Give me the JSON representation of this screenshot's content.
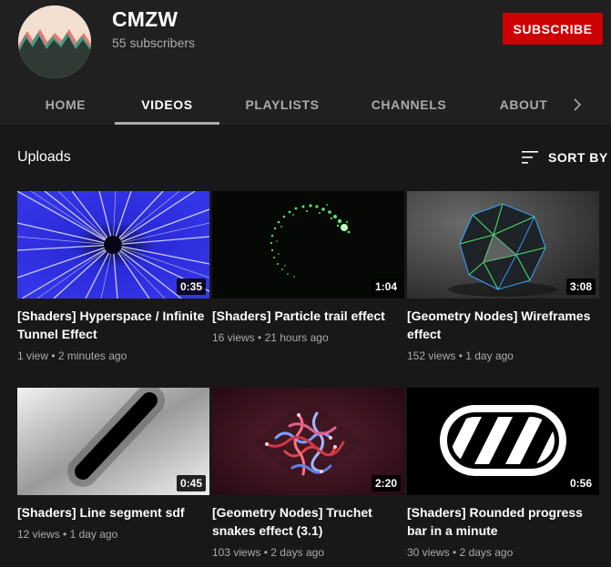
{
  "channel": {
    "name": "CMZW",
    "subscribers": "55 subscribers",
    "subscribe_label": "SUBSCRIBE"
  },
  "tabs": [
    {
      "label": "HOME",
      "active": false
    },
    {
      "label": "VIDEOS",
      "active": true
    },
    {
      "label": "PLAYLISTS",
      "active": false
    },
    {
      "label": "CHANNELS",
      "active": false
    },
    {
      "label": "ABOUT",
      "active": false
    }
  ],
  "section": {
    "title": "Uploads",
    "sort_label": "SORT BY"
  },
  "videos": [
    {
      "title": "[Shaders] Hyperspace / Infinite Tunnel Effect",
      "duration": "0:35",
      "views": "1 view",
      "age": "2 minutes ago"
    },
    {
      "title": "[Shaders] Particle trail effect",
      "duration": "1:04",
      "views": "16 views",
      "age": "21 hours ago"
    },
    {
      "title": "[Geometry Nodes] Wireframes effect",
      "duration": "3:08",
      "views": "152 views",
      "age": "1 day ago"
    },
    {
      "title": "[Shaders] Line segment sdf",
      "duration": "0:45",
      "views": "12 views",
      "age": "1 day ago"
    },
    {
      "title": "[Geometry Nodes] Truchet snakes effect (3.1)",
      "duration": "2:20",
      "views": "103 views",
      "age": "2 days ago"
    },
    {
      "title": "[Shaders] Rounded progress bar in a minute",
      "duration": "0:56",
      "views": "30 views",
      "age": "2 days ago"
    }
  ],
  "icons": {
    "avatar": "mountain-logo",
    "tabs_next": "chevron-right-icon",
    "sort": "sort-icon"
  },
  "colors": {
    "subscribe": "#cc0000",
    "header_bg": "#202020",
    "page_bg": "#181818"
  }
}
